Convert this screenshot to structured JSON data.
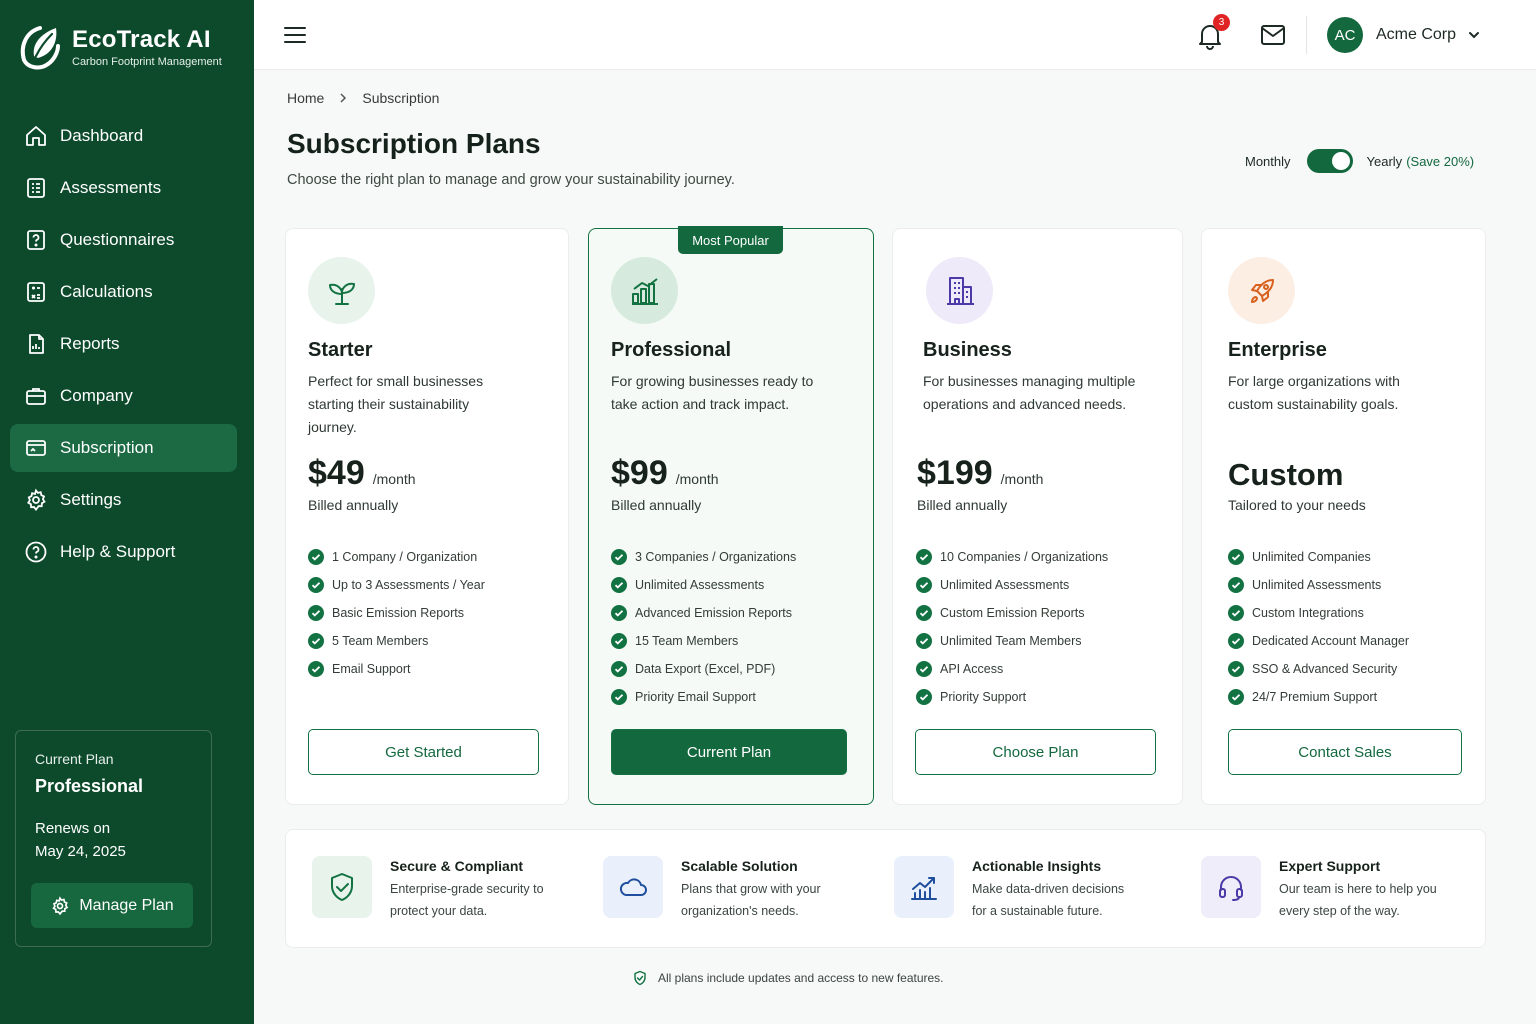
{
  "brand": {
    "name": "EcoTrack AI",
    "subtitle": "Carbon Footprint Management"
  },
  "sidebar": {
    "items": [
      {
        "label": "Dashboard",
        "icon": "home-icon"
      },
      {
        "label": "Assessments",
        "icon": "clipboard-list-icon"
      },
      {
        "label": "Questionnaires",
        "icon": "question-box-icon"
      },
      {
        "label": "Calculations",
        "icon": "calculator-icon"
      },
      {
        "label": "Reports",
        "icon": "report-icon"
      },
      {
        "label": "Company",
        "icon": "briefcase-icon"
      },
      {
        "label": "Subscription",
        "icon": "credit-card-icon",
        "active": true
      },
      {
        "label": "Settings",
        "icon": "gear-icon"
      },
      {
        "label": "Help & Support",
        "icon": "help-circle-icon"
      }
    ],
    "current_plan": {
      "label": "Current Plan",
      "name": "Professional",
      "renews_label": "Renews on",
      "renews_date": "May 24, 2025",
      "manage_label": "Manage Plan"
    }
  },
  "header": {
    "notification_count": "3",
    "user": {
      "initials": "AC",
      "name": "Acme Corp"
    }
  },
  "breadcrumb": {
    "home": "Home",
    "current": "Subscription"
  },
  "page": {
    "title": "Subscription Plans",
    "subtitle": "Choose the right plan to manage and grow your sustainability journey."
  },
  "billing_toggle": {
    "monthly": "Monthly",
    "yearly": "Yearly",
    "save": "(Save 20%)",
    "selected": "yearly"
  },
  "plans": [
    {
      "name": "Starter",
      "description": "Perfect for small businesses starting their sustainability journey.",
      "price": "$49",
      "period": "/month",
      "billed": "Billed annually",
      "icon": "sprout-icon",
      "icon_bg": "#e8f3ec",
      "icon_color": "#137242",
      "features": [
        "1 Company / Organization",
        "Up to 3 Assessments / Year",
        "Basic Emission Reports",
        "5 Team Members",
        "Email Support"
      ],
      "button": "Get Started"
    },
    {
      "name": "Professional",
      "badge": "Most Popular",
      "description": "For growing businesses ready to take action and track impact.",
      "price": "$99",
      "period": "/month",
      "billed": "Billed annually",
      "icon": "bar-chart-icon",
      "icon_bg": "#d6ebdd",
      "icon_color": "#137242",
      "features": [
        "3 Companies / Organizations",
        "Unlimited Assessments",
        "Advanced Emission Reports",
        "15 Team Members",
        "Data Export (Excel, PDF)",
        "Priority Email Support"
      ],
      "button": "Current Plan"
    },
    {
      "name": "Business",
      "description": "For businesses managing multiple operations and advanced needs.",
      "price": "$199",
      "period": "/month",
      "billed": "Billed annually",
      "icon": "building-icon",
      "icon_bg": "#eeeaf9",
      "icon_color": "#4b3aa8",
      "features": [
        "10 Companies / Organizations",
        "Unlimited Assessments",
        "Custom Emission Reports",
        "Unlimited Team Members",
        "API Access",
        "Priority Support"
      ],
      "button": "Choose Plan"
    },
    {
      "name": "Enterprise",
      "description": "For large organizations with custom sustainability goals.",
      "price": "Custom",
      "billed": "Tailored to your needs",
      "icon": "rocket-icon",
      "icon_bg": "#fdeee4",
      "icon_color": "#d9611e",
      "features": [
        "Unlimited Companies",
        "Unlimited Assessments",
        "Custom Integrations",
        "Dedicated Account Manager",
        "SSO & Advanced Security",
        "24/7 Premium Support"
      ],
      "button": "Contact Sales"
    }
  ],
  "highlights": [
    {
      "title": "Secure & Compliant",
      "desc": "Enterprise-grade security to protect your data.",
      "icon": "shield-check-icon",
      "bg": "#e8f3ec"
    },
    {
      "title": "Scalable Solution",
      "desc": "Plans that grow with your organization's needs.",
      "icon": "cloud-icon",
      "bg": "#eaf0fb"
    },
    {
      "title": "Actionable Insights",
      "desc": "Make data-driven decisions for a sustainable future.",
      "icon": "growth-chart-icon",
      "bg": "#eaf0fb"
    },
    {
      "title": "Expert Support",
      "desc": "Our team is here to help you every step of the way.",
      "icon": "headset-icon",
      "bg": "#efedf9"
    }
  ],
  "footer_note": "All plans include updates and access to new features.",
  "colors": {
    "brand_dark": "#0d4a2c",
    "brand": "#13683e",
    "accent_save": "#13683e",
    "badge_red": "#e02424"
  }
}
